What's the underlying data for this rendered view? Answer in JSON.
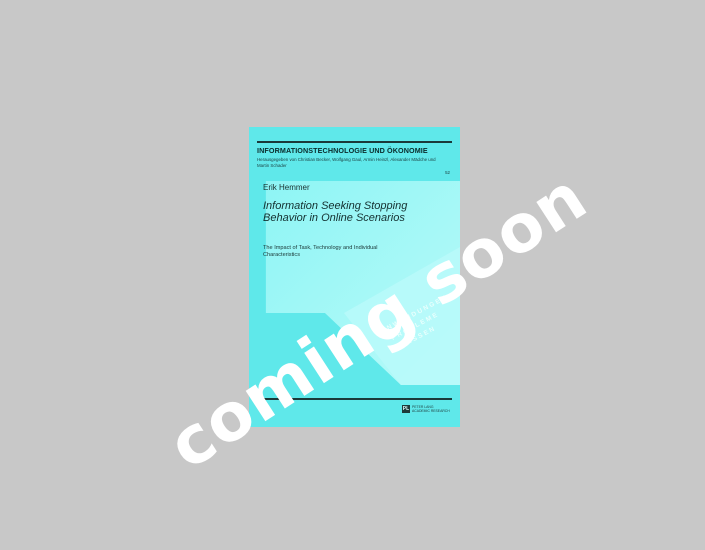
{
  "book": {
    "series_title": "INFORMATIONSTECHNOLOGIE UND ÖKONOMIE",
    "editors": "Herausgegeben von Christian Becker, Wolfgang Gaul, Armin Heinzl, Alexander Mädche und Martin Schader",
    "volume": "52",
    "author": "Erik Hemmer",
    "title": "Information Seeking Stopping Behavior in Online Scenarios",
    "subtitle": "The Impact of Task, Technology and Individual Characteristics",
    "stamp_line1": "ANWENDUNGEN",
    "stamp_line2": "PROBLEME",
    "stamp_line3": "WISSEN",
    "publisher_logo": "PL",
    "publisher_name": "PETER LANG ACADEMIC RESEARCH"
  },
  "overlay": {
    "watermark_text": "coming soon"
  },
  "colors": {
    "background": "#c8c8c8",
    "cover": "#5fe8ea",
    "watermark": "#ffffff"
  }
}
